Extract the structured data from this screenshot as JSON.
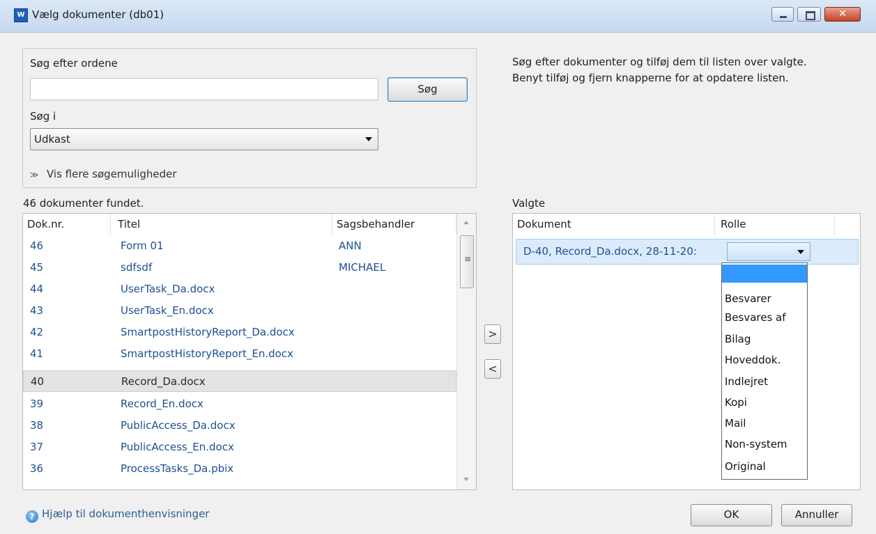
{
  "window": {
    "title": "Vælg dokumenter (db01)",
    "icon_label": "W",
    "close_glyph": "✕"
  },
  "search": {
    "words_label": "Søg efter ordene",
    "words_value": "",
    "search_button": "Søg",
    "search_in_label": "Søg i",
    "search_in_value": "Udkast",
    "more_options": "Vis flere søgemuligheder",
    "more_options_glyph": "≫"
  },
  "results": {
    "count_text": "46 dokumenter fundet.",
    "columns": [
      "Dok.nr.",
      "Titel",
      "Sagsbehandler"
    ],
    "rows": [
      {
        "nr": "46",
        "title": "Form 01",
        "handler": "ANN"
      },
      {
        "nr": "45",
        "title": "sdfsdf",
        "handler": "MICHAEL"
      },
      {
        "nr": "44",
        "title": "UserTask_Da.docx",
        "handler": ""
      },
      {
        "nr": "43",
        "title": "UserTask_En.docx",
        "handler": ""
      },
      {
        "nr": "42",
        "title": "SmartpostHistoryReport_Da.docx",
        "handler": ""
      },
      {
        "nr": "41",
        "title": "SmartpostHistoryReport_En.docx",
        "handler": ""
      },
      {
        "nr": "40",
        "title": "Record_Da.docx",
        "handler": ""
      },
      {
        "nr": "39",
        "title": "Record_En.docx",
        "handler": ""
      },
      {
        "nr": "38",
        "title": "PublicAccess_Da.docx",
        "handler": ""
      },
      {
        "nr": "37",
        "title": "PublicAccess_En.docx",
        "handler": ""
      },
      {
        "nr": "36",
        "title": "ProcessTasks_Da.pbix",
        "handler": ""
      }
    ],
    "selected_row_nr": "40"
  },
  "move": {
    "add_glyph": ">",
    "remove_glyph": "<"
  },
  "instructions": {
    "line1": "Søg efter dokumenter og tilføj dem til listen over valgte.",
    "line2": "Benyt tilføj og fjern knapperne for at opdatere listen."
  },
  "selected": {
    "label": "Valgte",
    "columns": [
      "Dokument",
      "Rolle"
    ],
    "rows": [
      {
        "document": "D-40, Record_Da.docx, 28-11-20:",
        "role": ""
      }
    ]
  },
  "role_dropdown": {
    "options": [
      "",
      "Besvarer",
      "Besvares af",
      "Bilag",
      "Hoveddok.",
      "Indlejret",
      "Kopi",
      "Mail",
      "Non-system",
      "Original"
    ],
    "highlighted_index": 0
  },
  "footer": {
    "help_link": "Hjælp til dokumenthenvisninger",
    "help_icon_glyph": "?",
    "ok_button": "OK",
    "cancel_button": "Annuller"
  },
  "colors": {
    "link_blue": "#1d4f91",
    "selection_blue": "#3399ff",
    "row_selected_gray": "#e3e3e3"
  }
}
